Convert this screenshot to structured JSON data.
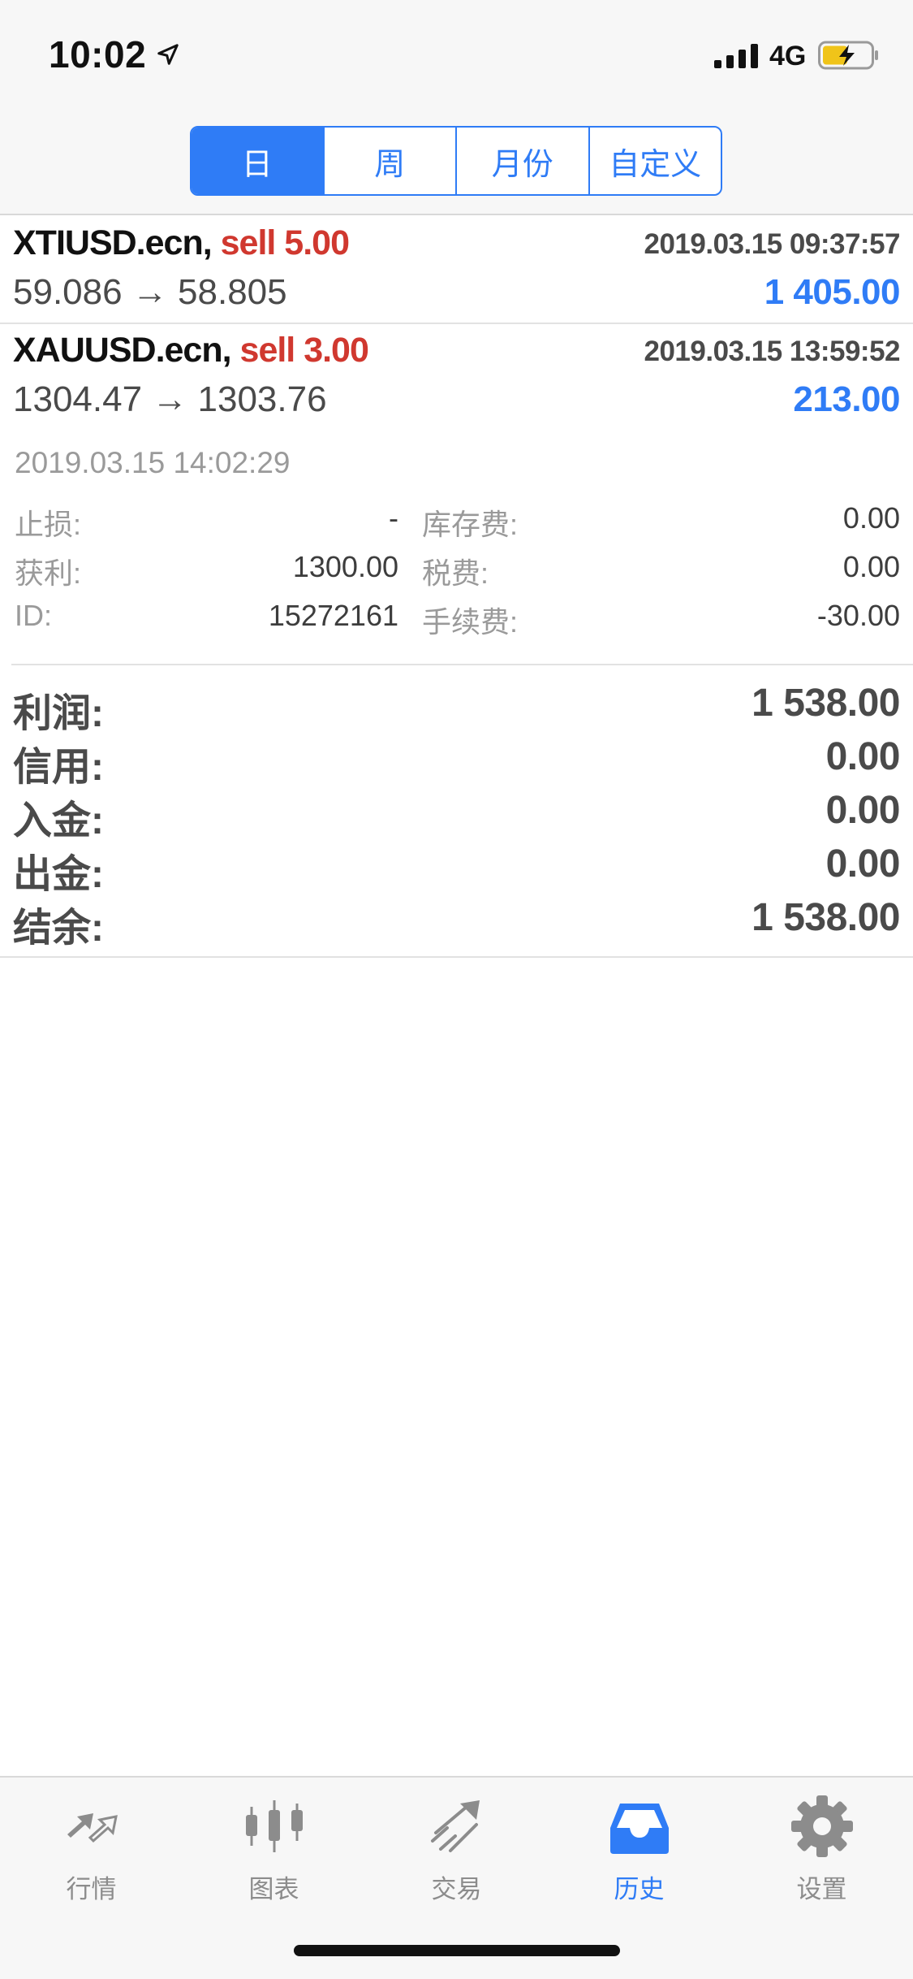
{
  "status_bar": {
    "time": "10:02",
    "network": "4G"
  },
  "segments": [
    {
      "label": "日",
      "active": true
    },
    {
      "label": "周",
      "active": false
    },
    {
      "label": "月份",
      "active": false
    },
    {
      "label": "自定义",
      "active": false
    }
  ],
  "deals": [
    {
      "symbol": "XTIUSD.ecn,",
      "side": "sell 5.00",
      "open_time": "2019.03.15 09:37:57",
      "prices": "59.086 → 58.805",
      "profit": "1 405.00"
    },
    {
      "symbol": "XAUUSD.ecn,",
      "side": "sell 3.00",
      "open_time": "2019.03.15 13:59:52",
      "prices": "1304.47 → 1303.76",
      "profit": "213.00",
      "close_time": "2019.03.15 14:02:29",
      "details": {
        "sl_label": "止损:",
        "sl_value": "-",
        "swap_label": "库存费:",
        "swap_value": "0.00",
        "tp_label": "获利:",
        "tp_value": "1300.00",
        "tax_label": "税费:",
        "tax_value": "0.00",
        "id_label": "ID:",
        "id_value": "15272161",
        "commission_label": "手续费:",
        "commission_value": "-30.00"
      }
    }
  ],
  "summary": [
    {
      "label": "利润:",
      "value": "1 538.00"
    },
    {
      "label": "信用:",
      "value": "0.00"
    },
    {
      "label": "入金:",
      "value": "0.00"
    },
    {
      "label": "出金:",
      "value": "0.00"
    },
    {
      "label": "结余:",
      "value": "1 538.00"
    }
  ],
  "tabs": [
    {
      "label": "行情",
      "icon": "quotes-icon",
      "active": false
    },
    {
      "label": "图表",
      "icon": "chart-icon",
      "active": false
    },
    {
      "label": "交易",
      "icon": "trade-icon",
      "active": false
    },
    {
      "label": "历史",
      "icon": "history-icon",
      "active": true
    },
    {
      "label": "设置",
      "icon": "gear-icon",
      "active": false
    }
  ],
  "colors": {
    "accent": "#2f7cf6",
    "sell": "#d0382f",
    "muted": "#9a9a9a"
  }
}
